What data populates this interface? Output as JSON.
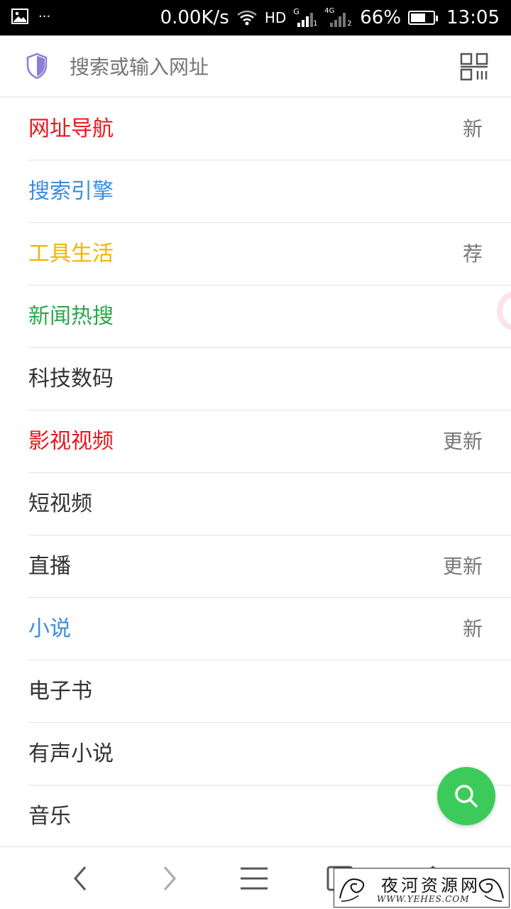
{
  "status_bar": {
    "network_speed": "0.00K/s",
    "hd_label": "HD",
    "sim1_type": "G",
    "sim1_index": "1",
    "sim2_type": "4G",
    "sim2_index": "2",
    "battery_percent": "66%",
    "battery_level": 0.66,
    "time": "13:05",
    "notification_more": "···"
  },
  "search": {
    "placeholder": "搜索或输入网址"
  },
  "menu": {
    "items": [
      {
        "label": "网址导航",
        "color": "#e8161c",
        "badge": "新"
      },
      {
        "label": "搜索引擎",
        "color": "#3b8de0",
        "badge": ""
      },
      {
        "label": "工具生活",
        "color": "#f5b300",
        "badge": "荐"
      },
      {
        "label": "新闻热搜",
        "color": "#2aa84a",
        "badge": ""
      },
      {
        "label": "科技数码",
        "color": "#333333",
        "badge": ""
      },
      {
        "label": "影视视频",
        "color": "#e8161c",
        "badge": "更新"
      },
      {
        "label": "短视频",
        "color": "#333333",
        "badge": ""
      },
      {
        "label": "直播",
        "color": "#333333",
        "badge": "更新"
      },
      {
        "label": "小说",
        "color": "#3b8de0",
        "badge": "新"
      },
      {
        "label": "电子书",
        "color": "#333333",
        "badge": ""
      },
      {
        "label": "有声小说",
        "color": "#333333",
        "badge": ""
      },
      {
        "label": "音乐",
        "color": "#333333",
        "badge": ""
      }
    ]
  },
  "colors": {
    "accent_green": "#3ccb5a",
    "shield_purple": "#8a7fd4"
  },
  "icons": {
    "shield": "shield-icon",
    "qr": "qr-scan-icon",
    "fab": "search-icon",
    "back": "chevron-left-icon",
    "forward": "chevron-right-icon",
    "menu": "hamburger-menu-icon",
    "tabs": "tabs-icon",
    "home": "home-icon"
  },
  "watermark": {
    "title": "夜河资源网",
    "subtitle": "WWW.YEHES.COM"
  }
}
